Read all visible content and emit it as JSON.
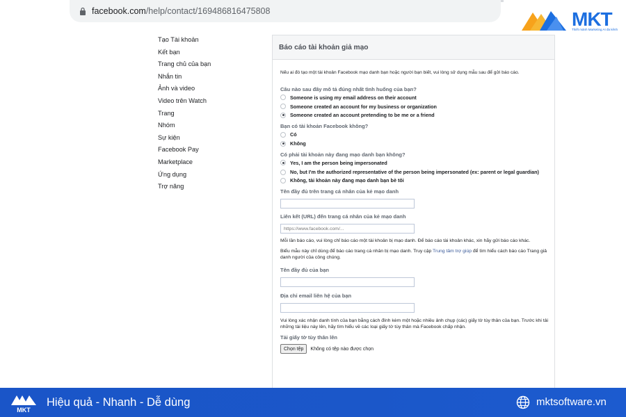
{
  "browser": {
    "url_host": "facebook.com",
    "url_path": "/help/contact/169486816475808"
  },
  "brand": {
    "name": "MKT",
    "tagline": "Thiết mảnh Marketing AI đa kênh",
    "accent": "#1d6fe0",
    "footer_slogan": "Hiệu quả - Nhanh - Dễ dùng",
    "footer_site": "mktsoftware.vn",
    "footer_bg": "#1a55c8"
  },
  "sidebar": {
    "items": [
      {
        "label": "Tạo Tài khoản"
      },
      {
        "label": "Kết bạn"
      },
      {
        "label": "Trang chủ của bạn"
      },
      {
        "label": "Nhắn tin"
      },
      {
        "label": "Ảnh và video"
      },
      {
        "label": "Video trên Watch"
      },
      {
        "label": "Trang"
      },
      {
        "label": "Nhóm"
      },
      {
        "label": "Sự kiện"
      },
      {
        "label": "Facebook Pay"
      },
      {
        "label": "Marketplace"
      },
      {
        "label": "Ứng dụng"
      },
      {
        "label": "Trợ năng"
      }
    ]
  },
  "form": {
    "title": "Báo cáo tài khoản giả mạo",
    "intro": "Nếu ai đó tạo một tài khoản Facebook mạo danh bạn hoặc người bạn biết, vui lòng sử dụng mẫu sau để gửi báo cáo.",
    "q1": {
      "label": "Câu nào sau đây mô tả đúng nhất tình huống của bạn?",
      "options": [
        {
          "label": "Someone is using my email address on their account",
          "checked": false
        },
        {
          "label": "Someone created an account for my business or organization",
          "checked": false
        },
        {
          "label": "Someone created an account pretending to be me or a friend",
          "checked": true
        }
      ]
    },
    "q2": {
      "label": "Bạn có tài khoản Facebook không?",
      "options": [
        {
          "label": "Có",
          "checked": false
        },
        {
          "label": "Không",
          "checked": true
        }
      ]
    },
    "q3": {
      "label": "Có phải tài khoản này đang mạo danh bạn không?",
      "options": [
        {
          "label": "Yes, I am the person being impersonated",
          "checked": true
        },
        {
          "label": "No, but I'm the authorized representative of the person being impersonated (ex: parent or legal guardian)",
          "checked": false
        },
        {
          "label": "Không, tài khoản này đang mạo danh bạn bè tôi",
          "checked": false
        }
      ]
    },
    "impostor_name": {
      "label": "Tên đầy đủ trên trang cá nhân của kẻ mạo danh",
      "value": ""
    },
    "impostor_url": {
      "label": "Liên kết (URL) đến trang cá nhân của kẻ mạo danh",
      "placeholder": "https://www.facebook.com/..."
    },
    "note1": "Mỗi lần báo cáo, vui lòng chỉ báo cáo một tài khoản bị mạo danh. Để báo cáo tài khoản khác, xin hãy gửi báo cáo khác.",
    "note2_pre": "Biểu mẫu này chỉ dùng để báo cáo trang cá nhân bị mạo danh. Truy cập ",
    "note2_link": "Trung tâm trợ giúp",
    "note2_post": " để tìm hiểu cách báo cáo Trang giả danh người của công chúng.",
    "your_name": {
      "label": "Tên đầy đủ của bạn",
      "value": ""
    },
    "your_email": {
      "label": "Địa chỉ email liên hệ của bạn",
      "value": ""
    },
    "note3": "Vui lòng xác nhận danh tính của bạn bằng cách đính kèm một hoặc nhiều ảnh chụp (các) giấy tờ tùy thân của bạn. Trước khi tải những tài liệu này lên, hãy tìm hiểu về các loại giấy tờ tùy thân mà Facebook chấp nhận.",
    "upload": {
      "label": "Tải giấy tờ tùy thân lên",
      "button": "Chọn tệp",
      "status": "Không có tệp nào được chọn"
    }
  }
}
